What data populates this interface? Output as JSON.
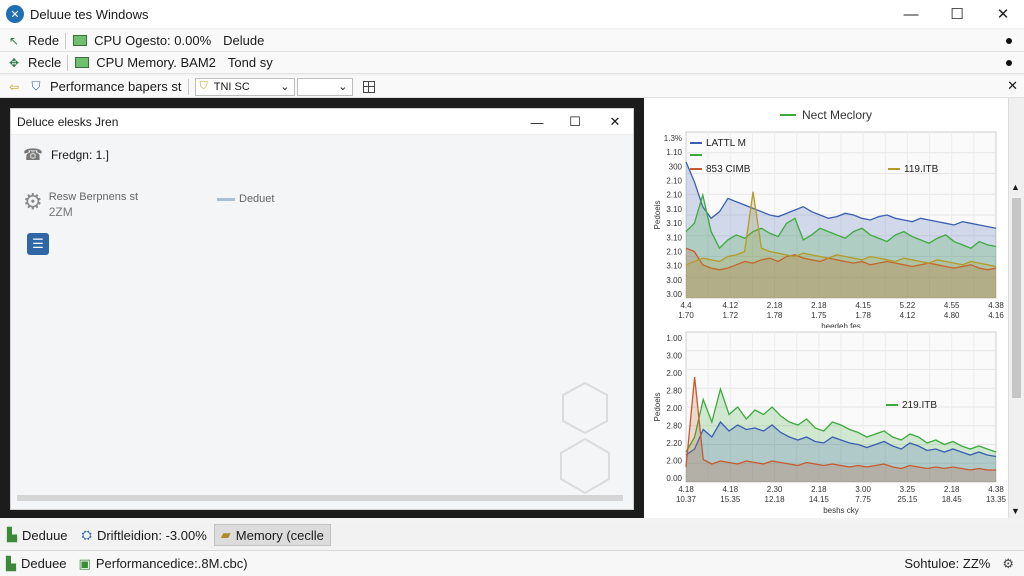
{
  "window": {
    "title": "Deluue tes Windows"
  },
  "toolbar1": {
    "item1": "Rede",
    "item2": "CPU Ogesto: 0.00%",
    "item3": "Delude"
  },
  "toolbar2": {
    "item1": "Recle",
    "item2": "CPU Memory. BAM2",
    "item3": "Tond sy"
  },
  "toolbar3": {
    "item1": "Performance bapers st",
    "combo1": "TNI SC",
    "combo2": ""
  },
  "inner_window": {
    "title": "Deluce elesks Jren",
    "row1": "Fredgn: 1.]",
    "row2_label": "Resw Berpnens st",
    "row2_value": "2ZM",
    "row2_right": "Deduet"
  },
  "chart_legend_title": "Nect Meclory",
  "chart_data": [
    {
      "type": "line",
      "x": [
        "1.70",
        "1.72",
        "1.78",
        "1.75",
        "1.78",
        "4.12",
        "4.80",
        "4.16"
      ],
      "x_top": [
        "4.4",
        "4.12",
        "2.18",
        "2.18",
        "4.15",
        "5.22",
        "4.55",
        "4.38"
      ],
      "y_ticks": [
        "1.3%",
        "1.10",
        "300",
        "2.10",
        "2.10",
        "3.10",
        "3.10",
        "3.10",
        "2.10",
        "3.10",
        "3.00",
        "3.00"
      ],
      "xlabel": "heedeh fes",
      "ylabel": "Pedoeis",
      "legend": [
        "LATTL M",
        "",
        "853 CIMB",
        "119.ITB"
      ],
      "series": [
        {
          "name": "LATTL M",
          "color": "#3b5fb0",
          "values": [
            82,
            70,
            55,
            48,
            52,
            60,
            58,
            56,
            54,
            52,
            50,
            49,
            51,
            53,
            55,
            52,
            50,
            48,
            49,
            51,
            50,
            48,
            47,
            49,
            50,
            48,
            47,
            46,
            48,
            47,
            46,
            45,
            44,
            46,
            45,
            44,
            43,
            42
          ]
        },
        {
          "name": "",
          "color": "#3daa3d",
          "values": [
            40,
            45,
            62,
            40,
            30,
            35,
            38,
            36,
            40,
            42,
            39,
            37,
            45,
            48,
            35,
            38,
            42,
            40,
            38,
            36,
            40,
            42,
            38,
            36,
            34,
            38,
            40,
            37,
            35,
            33,
            36,
            38,
            34,
            32,
            30,
            34,
            32,
            31
          ]
        },
        {
          "name": "853 CIMB",
          "color": "#c65a2e",
          "values": [
            30,
            28,
            20,
            18,
            17,
            18,
            20,
            22,
            21,
            23,
            24,
            22,
            25,
            26,
            24,
            23,
            22,
            24,
            23,
            22,
            21,
            22,
            20,
            21,
            22,
            21,
            20,
            19,
            20,
            21,
            20,
            19,
            18,
            19,
            20,
            18,
            17,
            18
          ]
        },
        {
          "name": "119.ITB",
          "color": "#b39b2a",
          "values": [
            20,
            22,
            24,
            23,
            22,
            25,
            26,
            28,
            64,
            30,
            28,
            27,
            26,
            25,
            27,
            26,
            25,
            24,
            26,
            25,
            24,
            23,
            25,
            24,
            23,
            22,
            24,
            23,
            22,
            21,
            23,
            22,
            21,
            20,
            22,
            21,
            20,
            19
          ]
        }
      ]
    },
    {
      "type": "line",
      "x": [
        "10.37",
        "15.35",
        "12.18",
        "14.15",
        "7.75",
        "25.15",
        "18.45",
        "13.35"
      ],
      "x_top": [
        "4.18",
        "4.18",
        "2.30",
        "2.18",
        "3.00",
        "3.25",
        "2.18",
        "4.38"
      ],
      "y_ticks": [
        "1.00",
        "3.00",
        "2.00",
        "2.80",
        "2.00",
        "2.80",
        "2.20",
        "2.00",
        "0.00"
      ],
      "xlabel": "beshs cky",
      "ylabel": "Pedoeis",
      "legend": [
        "219.ITB"
      ],
      "series": [
        {
          "name": "219.ITB",
          "color": "#3daa3d",
          "values": [
            20,
            30,
            55,
            40,
            62,
            45,
            50,
            42,
            48,
            45,
            50,
            44,
            40,
            38,
            42,
            36,
            34,
            40,
            38,
            35,
            33,
            30,
            32,
            34,
            30,
            28,
            32,
            30,
            26,
            28,
            25,
            27,
            24,
            22,
            24,
            22,
            20
          ]
        },
        {
          "name": "",
          "color": "#3b5fb0",
          "values": [
            18,
            22,
            35,
            30,
            40,
            34,
            38,
            35,
            36,
            34,
            38,
            33,
            30,
            28,
            30,
            27,
            26,
            30,
            28,
            26,
            25,
            23,
            25,
            27,
            24,
            22,
            26,
            24,
            21,
            22,
            20,
            22,
            20,
            18,
            20,
            18,
            17
          ]
        },
        {
          "name": "",
          "color": "#c65a2e",
          "values": [
            10,
            70,
            15,
            12,
            14,
            13,
            12,
            14,
            13,
            12,
            14,
            13,
            12,
            11,
            13,
            12,
            11,
            12,
            11,
            10,
            11,
            10,
            11,
            12,
            10,
            9,
            11,
            10,
            9,
            10,
            9,
            10,
            9,
            8,
            9,
            8,
            8
          ]
        }
      ]
    }
  ],
  "bottom_tabs": {
    "tab1": "Deduue",
    "tab2": "Driftleidion: -3.00%",
    "tab3": "Memory (ceclle"
  },
  "statusbar": {
    "left1": "Deduee",
    "left2": "Performancedice:.8M.cbc)",
    "right": "Sohtuloe: ZZ%"
  }
}
